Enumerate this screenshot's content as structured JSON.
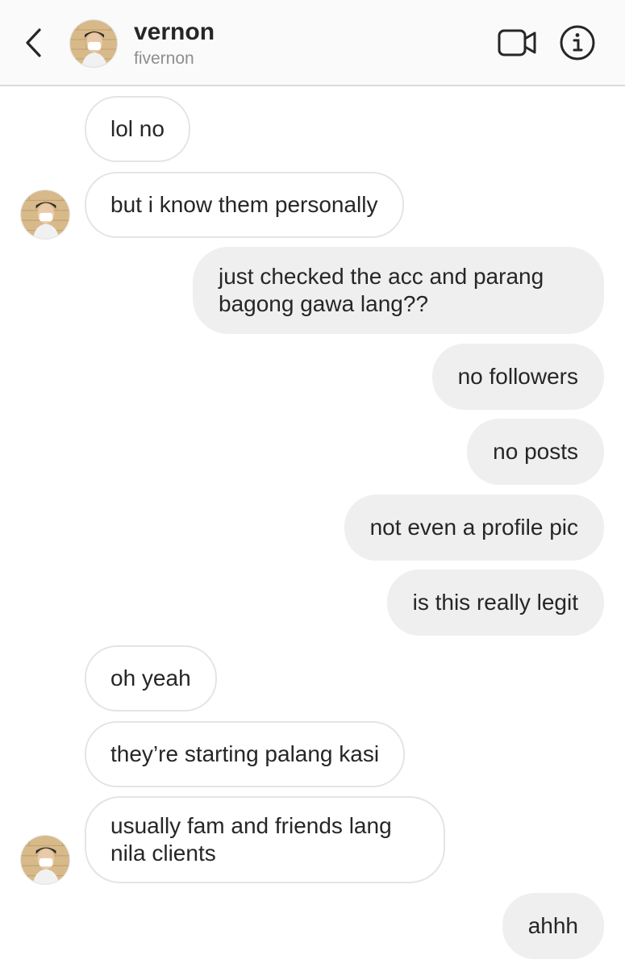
{
  "header": {
    "name": "vernon",
    "username": "fivernon",
    "icons": {
      "back": "chevron-left-icon",
      "video": "video-camera-icon",
      "info": "info-icon"
    }
  },
  "messages": [
    {
      "direction": "incoming",
      "text": "lol no"
    },
    {
      "direction": "incoming",
      "text": "but i know them personally",
      "avatar": true
    },
    {
      "direction": "outgoing",
      "text": "just checked the acc and parang bagong gawa lang??"
    },
    {
      "direction": "outgoing",
      "text": "no followers"
    },
    {
      "direction": "outgoing",
      "text": "no posts"
    },
    {
      "direction": "outgoing",
      "text": "not even a profile pic"
    },
    {
      "direction": "outgoing",
      "text": "is this really legit"
    },
    {
      "direction": "incoming",
      "text": "oh yeah"
    },
    {
      "direction": "incoming",
      "text": "they’re starting palang kasi"
    },
    {
      "direction": "incoming",
      "text": "usually fam and friends lang nila clients",
      "avatar": true
    },
    {
      "direction": "outgoing",
      "text": "ahhh"
    }
  ],
  "colors": {
    "incoming_bubble": "#ffffff",
    "incoming_border": "#e4e4e4",
    "outgoing_bubble": "#efefef",
    "header_bg": "#fafafa",
    "text": "#262626",
    "secondary_text": "#8e8e8e"
  }
}
